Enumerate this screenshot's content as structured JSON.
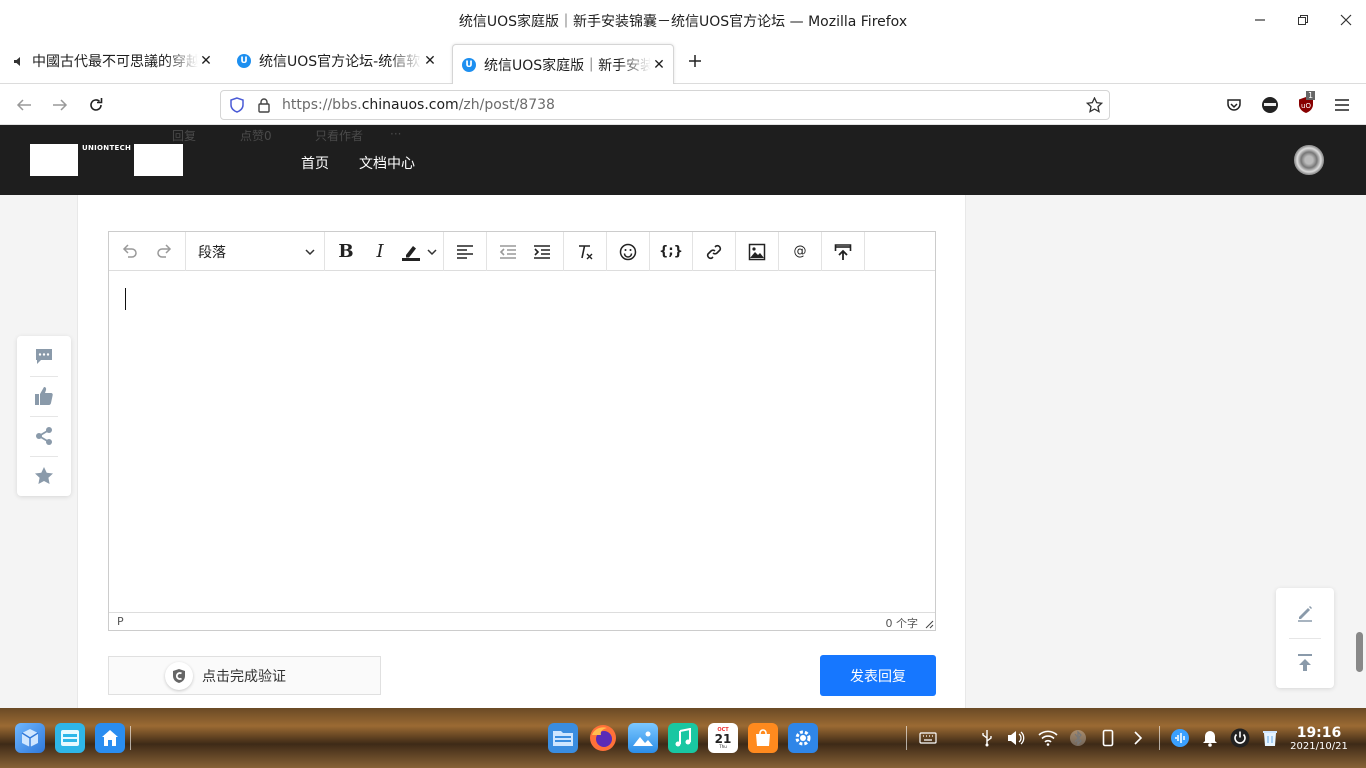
{
  "window": {
    "title": "统信UOS家庭版｜新手安装锦囊－统信UOS官方论坛 — Mozilla Firefox"
  },
  "tabs": [
    {
      "label": "中國古代最不可思議的穿越",
      "active": false
    },
    {
      "label": "统信UOS官方论坛-统信软件",
      "active": false
    },
    {
      "label": "统信UOS家庭版｜新手安装锦囊",
      "active": true
    }
  ],
  "navbar": {
    "url_prefix": "https://bbs.",
    "url_domain": "chinauos.com",
    "url_path": "/zh/post/8738",
    "ublock_badge": "1"
  },
  "site_header": {
    "logo_text": "UNIONTECH",
    "nav": [
      "首页",
      "文档中心"
    ],
    "ghost_actions": [
      "回复",
      "点赞0",
      "只看作者",
      "···"
    ]
  },
  "editor": {
    "block_format": "段落",
    "status_path": "P",
    "word_count": "0 个字"
  },
  "captcha": {
    "label": "点击完成验证"
  },
  "submit": {
    "label": "发表回复"
  },
  "taskbar": {
    "calendar_month": "OCT",
    "calendar_day": "21",
    "calendar_weekday": "Thu",
    "time": "19:16",
    "date": "2021/10/21"
  },
  "colors": {
    "accent": "#1677ff",
    "header_bg": "#1e1e1e"
  }
}
